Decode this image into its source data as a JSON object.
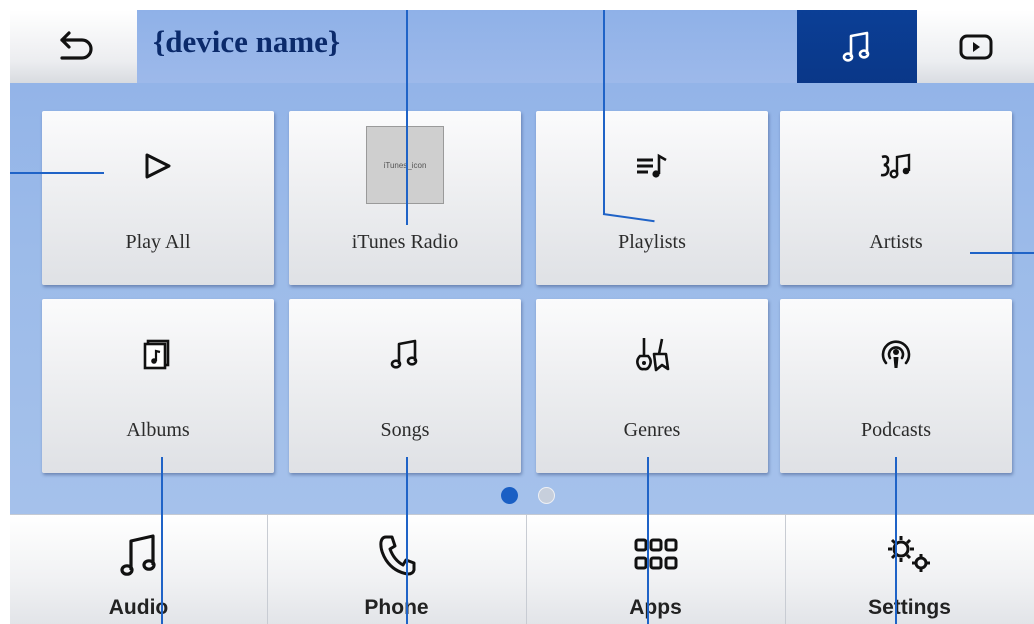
{
  "header": {
    "title": "{device name}",
    "back_icon": "back-arrow-icon",
    "music_tab_icon": "music-note-icon",
    "video_tab_icon": "play-circle-icon",
    "active_tab_color": "#0b3f96"
  },
  "grid": {
    "tiles": [
      {
        "label": "Play All",
        "icon": "play-icon"
      },
      {
        "label": "iTunes Radio",
        "icon": "itunes-icon",
        "image_text": "iTunes_icon"
      },
      {
        "label": "Playlists",
        "icon": "playlist-icon"
      },
      {
        "label": "Artists",
        "icon": "artists-icon"
      },
      {
        "label": "Albums",
        "icon": "album-icon"
      },
      {
        "label": "Songs",
        "icon": "music-note-icon"
      },
      {
        "label": "Genres",
        "icon": "guitars-icon"
      },
      {
        "label": "Podcasts",
        "icon": "podcast-icon"
      }
    ]
  },
  "pager": {
    "current_page": 1,
    "total_pages": 2
  },
  "bottom_nav": {
    "items": [
      {
        "label": "Audio",
        "icon": "music-note-icon"
      },
      {
        "label": "Phone",
        "icon": "phone-icon"
      },
      {
        "label": "Apps",
        "icon": "apps-grid-icon"
      },
      {
        "label": "Settings",
        "icon": "gears-icon"
      }
    ]
  },
  "colors": {
    "background": "#9cbbe9",
    "accent": "#1a5fc4",
    "annotation_line": "#1f63c7"
  }
}
